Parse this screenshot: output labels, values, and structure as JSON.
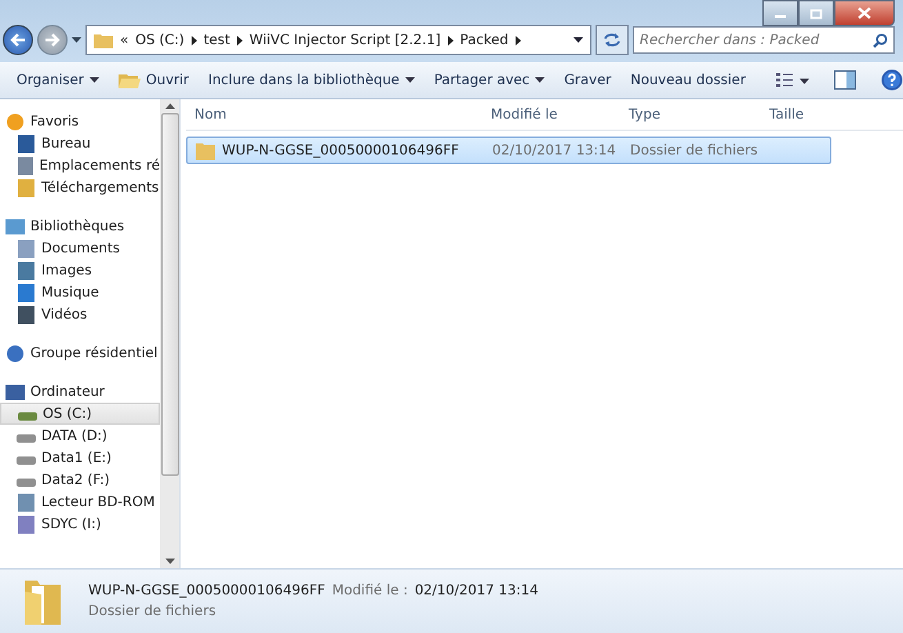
{
  "address_bar": {
    "overflow": "«",
    "crumbs": [
      "OS (C:)",
      "test",
      "WiiVC Injector Script [2.2.1]",
      "Packed"
    ]
  },
  "search": {
    "placeholder": "Rechercher dans : Packed"
  },
  "toolbar": [
    {
      "label": "Organiser",
      "dropdown": true,
      "kind": "text"
    },
    {
      "label": "Ouvrir",
      "dropdown": false,
      "kind": "open"
    },
    {
      "label": "Inclure dans la bibliothèque",
      "dropdown": true,
      "kind": "text"
    },
    {
      "label": "Partager avec",
      "dropdown": true,
      "kind": "text"
    },
    {
      "label": "Graver",
      "dropdown": false,
      "kind": "text"
    },
    {
      "label": "Nouveau dossier",
      "dropdown": false,
      "kind": "text"
    }
  ],
  "sidebar": {
    "groups": [
      {
        "label": "Favoris",
        "kind": "star",
        "children": [
          {
            "label": "Bureau",
            "kind": "desktop",
            "selected": false
          },
          {
            "label": "Emplacements ré",
            "kind": "places",
            "selected": false
          },
          {
            "label": "Téléchargements",
            "kind": "download",
            "selected": false
          }
        ]
      },
      {
        "label": "Bibliothèques",
        "kind": "library",
        "children": [
          {
            "label": "Documents",
            "kind": "document",
            "selected": false
          },
          {
            "label": "Images",
            "kind": "image",
            "selected": false
          },
          {
            "label": "Musique",
            "kind": "music",
            "selected": false
          },
          {
            "label": "Vidéos",
            "kind": "video",
            "selected": false
          }
        ]
      },
      {
        "label": "Groupe résidentiel",
        "kind": "homegroup"
      },
      {
        "label": "Ordinateur",
        "kind": "computer",
        "children": [
          {
            "label": "OS (C:)",
            "kind": "osdrive",
            "selected": true
          },
          {
            "label": "DATA (D:)",
            "kind": "drive",
            "selected": false
          },
          {
            "label": "Data1 (E:)",
            "kind": "drive",
            "selected": false
          },
          {
            "label": "Data2 (F:)",
            "kind": "drive",
            "selected": false
          },
          {
            "label": "Lecteur BD-ROM",
            "kind": "disc",
            "selected": false
          },
          {
            "label": "SDYC (I:)",
            "kind": "card",
            "selected": false
          }
        ]
      }
    ]
  },
  "table": {
    "columns": [
      "Nom",
      "Modifié le",
      "Type",
      "Taille"
    ],
    "rows": [
      {
        "name": "WUP-N-GGSE_00050000106496FF",
        "modified": "02/10/2017 13:14",
        "type": "Dossier de fichiers",
        "selected": true
      }
    ]
  },
  "details": {
    "name": "WUP-N-GGSE_00050000106496FF",
    "modified_label": "Modifié le :",
    "modified": "02/10/2017 13:14",
    "type": "Dossier de fichiers"
  }
}
